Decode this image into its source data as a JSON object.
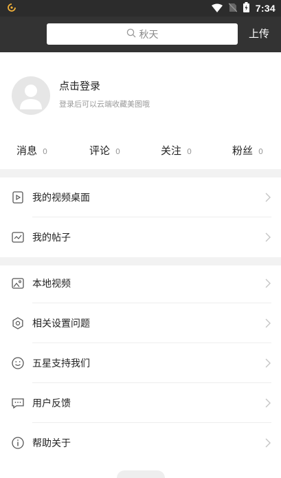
{
  "status_bar": {
    "time": "7:34",
    "left_icon": "app-notification-icon",
    "right_icons": [
      "wifi-icon",
      "no-sim-icon",
      "battery-icon"
    ]
  },
  "top_bar": {
    "search_placeholder": "秋天",
    "upload_label": "上传",
    "search_icon": "search-icon"
  },
  "profile": {
    "title": "点击登录",
    "subtitle": "登录后可以云端收藏美图哦"
  },
  "stats": [
    {
      "label": "消息",
      "count": "0"
    },
    {
      "label": "评论",
      "count": "0"
    },
    {
      "label": "关注",
      "count": "0"
    },
    {
      "label": "粉丝",
      "count": "0"
    }
  ],
  "menu_group_1": [
    {
      "label": "我的视频桌面",
      "icon": "video-file-icon"
    },
    {
      "label": "我的帖子",
      "icon": "post-icon"
    }
  ],
  "menu_group_2": [
    {
      "label": "本地视频",
      "icon": "image-icon"
    },
    {
      "label": "相关设置问题",
      "icon": "settings-icon"
    },
    {
      "label": "五星支持我们",
      "icon": "smile-icon"
    },
    {
      "label": "用户反馈",
      "icon": "feedback-icon"
    },
    {
      "label": "帮助关于",
      "icon": "info-icon"
    }
  ],
  "colors": {
    "status_bar": "#2c2c2c",
    "top_bar": "#333333",
    "band": "#f2f2f2"
  }
}
